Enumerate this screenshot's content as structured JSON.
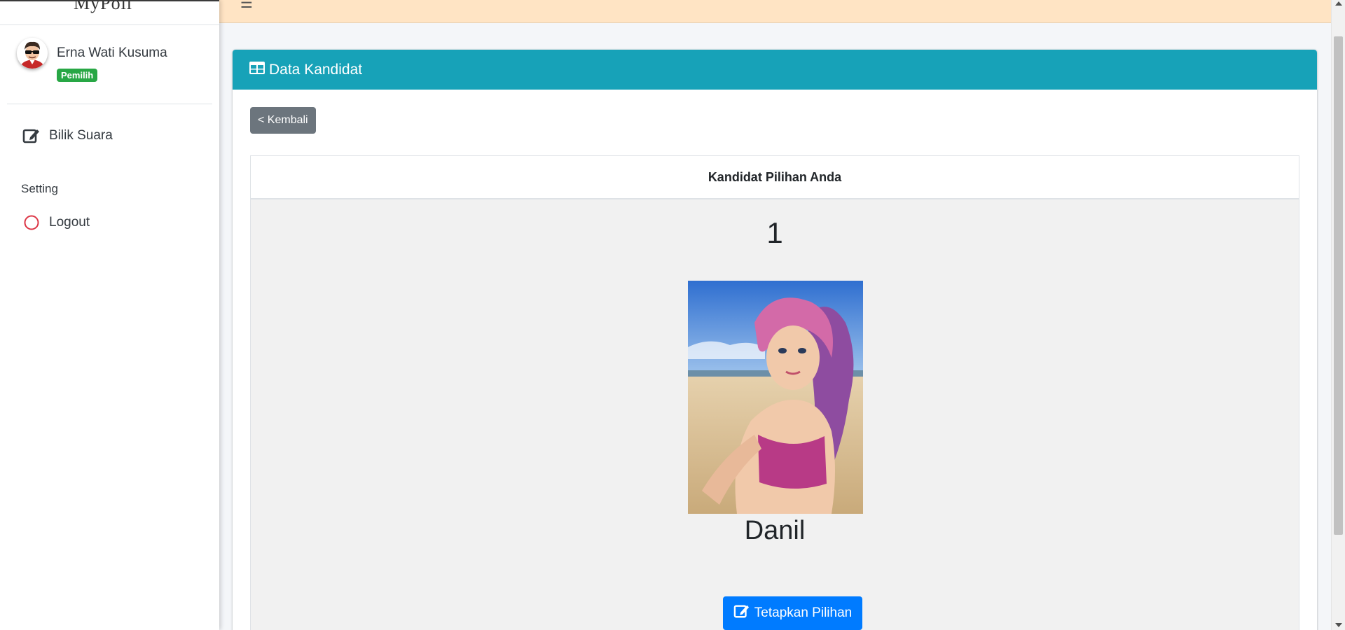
{
  "brand": {
    "name": "MyPoll"
  },
  "user": {
    "name": "Erna Wati Kusuma",
    "role_badge": "Pemilih"
  },
  "sidebar": {
    "items": [
      {
        "label": "Bilik Suara",
        "icon": "edit-icon"
      }
    ],
    "section_header": "Setting",
    "settings_items": [
      {
        "label": "Logout",
        "icon": "circle-icon"
      }
    ]
  },
  "card": {
    "title": "Data Kandidat",
    "back_button": "< Kembali",
    "choice_header": "Kandidat Pilihan Anda",
    "candidate": {
      "number": "1",
      "name": "Danil"
    },
    "confirm_button": "Tetapkan Pilihan"
  },
  "colors": {
    "navbar": "#ffe4c4",
    "card_header": "#17a2b8",
    "badge": "#28a745",
    "back_button": "#6c757d",
    "confirm_button": "#007bff",
    "logout_icon": "#dc3545"
  }
}
